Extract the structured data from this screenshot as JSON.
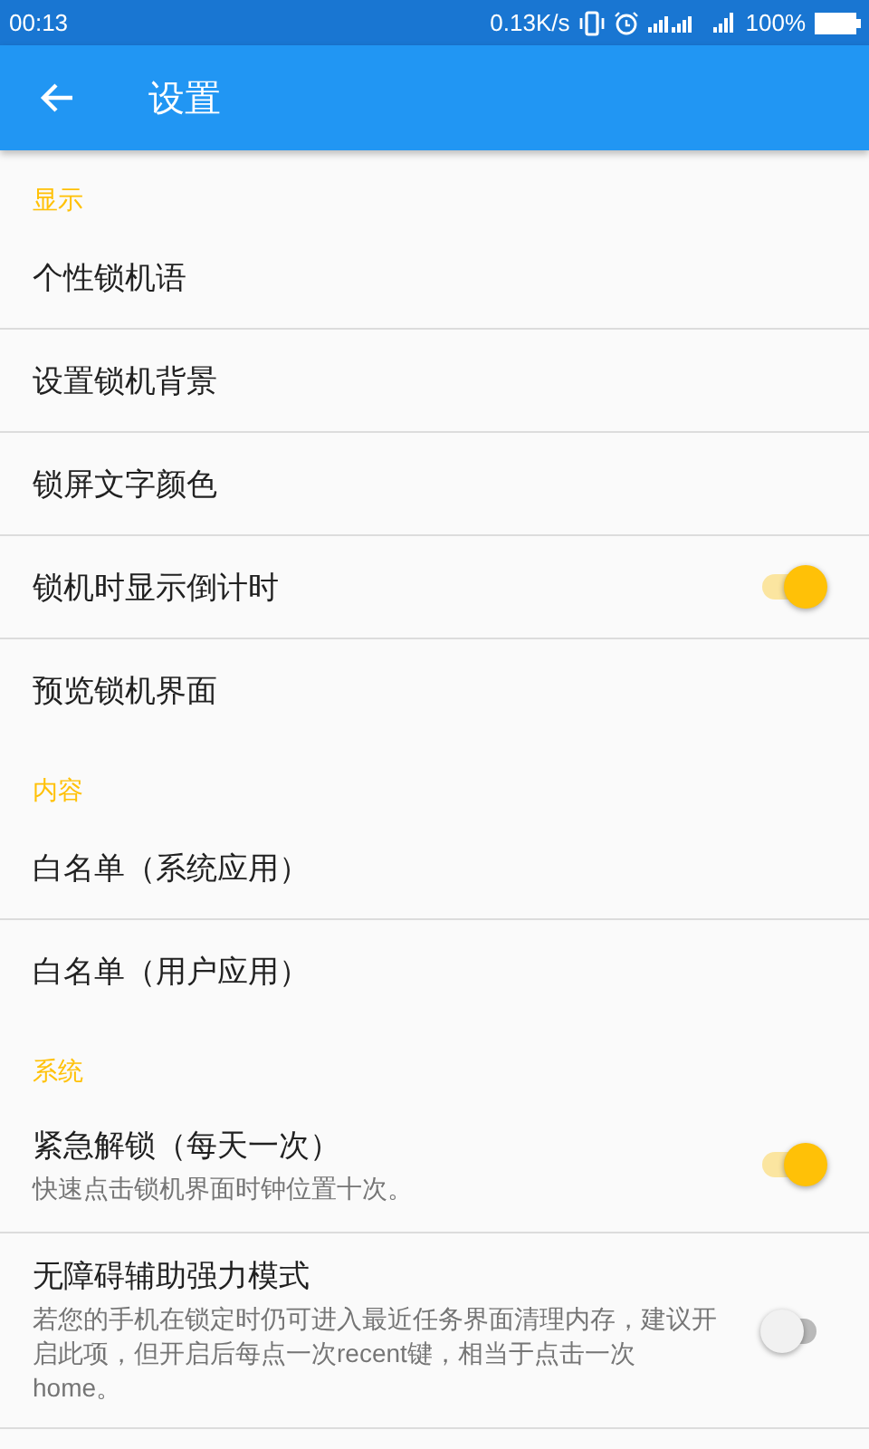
{
  "status_bar": {
    "time": "00:13",
    "speed": "0.13K/s",
    "battery": "100%"
  },
  "app_bar": {
    "title": "设置"
  },
  "sections": [
    {
      "header": "显示",
      "items": [
        {
          "kind": "plain",
          "title": "个性锁机语"
        },
        {
          "kind": "plain",
          "title": "设置锁机背景"
        },
        {
          "kind": "plain",
          "title": "锁屏文字颜色"
        },
        {
          "kind": "switch",
          "title": "锁机时显示倒计时",
          "on": true
        },
        {
          "kind": "plain",
          "title": "预览锁机界面"
        }
      ]
    },
    {
      "header": "内容",
      "items": [
        {
          "kind": "plain",
          "title": "白名单（系统应用）"
        },
        {
          "kind": "plain",
          "title": "白名单（用户应用）"
        }
      ]
    },
    {
      "header": "系统",
      "items": [
        {
          "kind": "switch",
          "title": "紧急解锁（每天一次）",
          "summary": "快速点击锁机界面时钟位置十次。",
          "on": true
        },
        {
          "kind": "switch",
          "title": "无障碍辅助强力模式",
          "summary": "若您的手机在锁定时仍可进入最近任务界面清理内存，建议开启此项，但开启后每点一次recent键，相当于点击一次home。",
          "on": false
        }
      ]
    }
  ]
}
